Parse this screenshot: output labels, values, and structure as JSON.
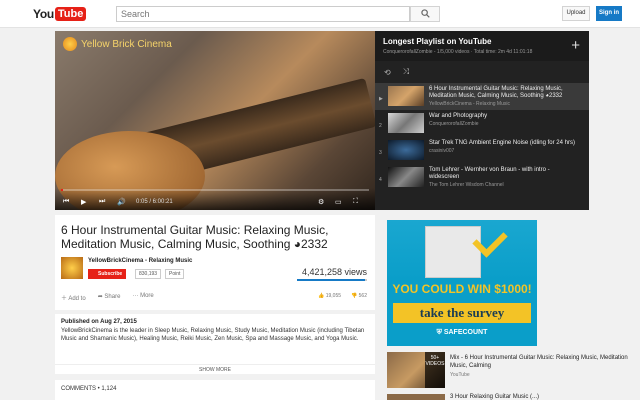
{
  "header": {
    "logo_you": "You",
    "logo_tube": "Tube",
    "search_placeholder": "Search",
    "upload_label": "Upload",
    "signin_label": "Sign in"
  },
  "player": {
    "channel_watermark": "Yellow Brick Cinema",
    "time": "0:05 / 6:00:21",
    "progress": 0.006
  },
  "playlist": {
    "title": "Longest Playlist on YouTube",
    "meta": "ConquerorofallZombie - 1/5,000 videos · Total time: 2m 4d 11:01:18",
    "items": [
      {
        "num": "▶",
        "title": "6 Hour Instrumental Guitar Music: Relaxing Music, Meditation Music, Calming Music, Soothing ◕2332",
        "by": "YellowBrickCinema - Relaxing Music",
        "active": true
      },
      {
        "num": "2",
        "title": "War and Photography",
        "by": "ConquerorofallZombie",
        "active": false
      },
      {
        "num": "3",
        "title": "Star Trek TNG Ambient Engine Noise (idling for 24 hrs)",
        "by": "crasiniv007",
        "active": false
      },
      {
        "num": "4",
        "title": "Tom Lehrer - Wernher von Braun - with intro - widescreen",
        "by": "The Tom Lehrer Wisdom Channel",
        "active": false
      }
    ]
  },
  "video": {
    "title": "6 Hour Instrumental Guitar Music: Relaxing Music, Meditation Music, Calming Music, Soothing ◕2332",
    "channel": "YellowBrickCinema - Relaxing Music",
    "subscribe_label": "Subscribe",
    "subscriber_count": "830,193",
    "point_label": "Point",
    "views": "4,421,258 views",
    "like_ratio": 0.97,
    "likes": "19,055",
    "dislikes": "562",
    "add_label": "Add to",
    "share_label": "Share",
    "more_label": "More"
  },
  "description": {
    "published": "Published on Aug 27, 2015",
    "text": "YellowBrickCinema is the leader in Sleep Music, Relaxing Music, Study Music, Meditation Music (including Tibetan Music and Shamanic Music), Healing Music, Reiki Music, Zen Music, Spa and Massage Music, and Yoga Music.",
    "show_more": "SHOW MORE"
  },
  "comments": {
    "label": "COMMENTS • 1,124"
  },
  "ad": {
    "headline": "YOU COULD WIN $1000!",
    "cta": "take the survey",
    "brand": "⛨ SAFECOUNT"
  },
  "recommendations": [
    {
      "badge": "50+ VIDEOS",
      "title": "Mix - 6 Hour Instrumental Guitar Music: Relaxing Music, Meditation Music, Calming",
      "by": "YouTube"
    },
    {
      "title": "3 Hour Relaxing Guitar Music (...)"
    }
  ]
}
